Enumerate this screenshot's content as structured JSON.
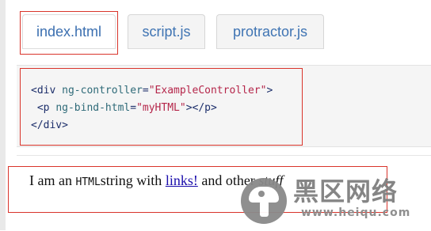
{
  "tabs": [
    {
      "label": "index.html",
      "active": true
    },
    {
      "label": "script.js",
      "active": false
    },
    {
      "label": "protractor.js",
      "active": false
    }
  ],
  "code": {
    "line1": {
      "open": "<div ",
      "attr": "ng-controller",
      "eq": "=",
      "value": "\"ExampleController\"",
      "close": ">"
    },
    "line2": {
      "indent": " ",
      "open": "<p ",
      "attr": "ng-bind-html",
      "eq": "=",
      "value": "\"myHTML\"",
      "close": "></p>"
    },
    "line3": {
      "text": "</div>"
    }
  },
  "result": {
    "before_code": "I am an ",
    "code": "HTML",
    "after_code": "string with ",
    "link": "links!",
    "middle": " and other ",
    "italic": "stuff"
  },
  "watermark": {
    "cn": "黑区网络",
    "url": "www.heiqu.com"
  },
  "colors": {
    "tab_text": "#3b6fb0",
    "highlight_box": "#d9342b",
    "code_tag": "#1d2f6b",
    "code_attr": "#2e6a78",
    "code_value": "#b5264a",
    "link": "#1a0dab"
  }
}
